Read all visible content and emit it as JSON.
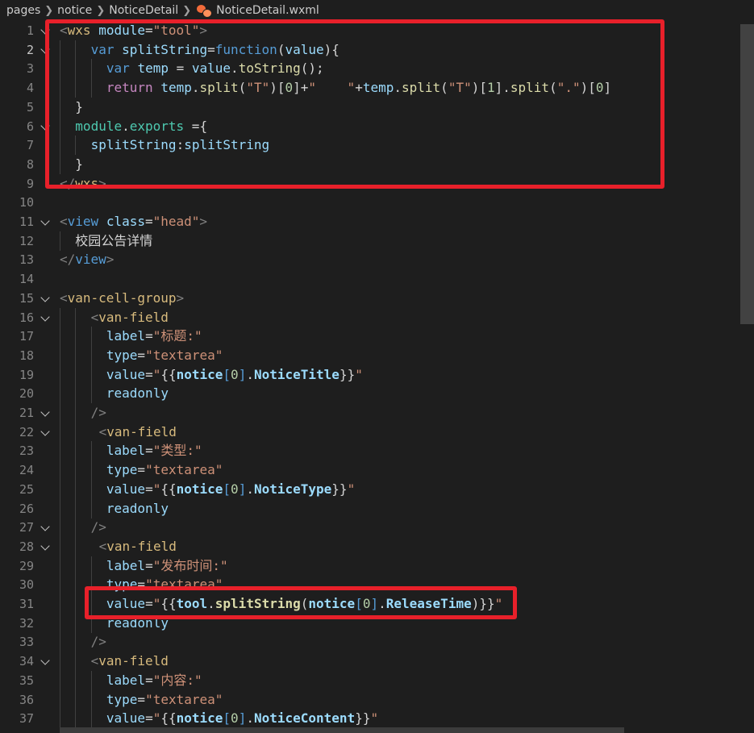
{
  "breadcrumb": {
    "items": [
      "pages",
      "notice",
      "NoticeDetail",
      "NoticeDetail.wxml"
    ],
    "file_icon": "wechat-file-icon"
  },
  "colors": {
    "tag": "#569cd6",
    "attr": "#9cdcfe",
    "string": "#ce9178",
    "text": "#d4d4d4",
    "keyword": "#569cd6",
    "function": "#dcdcaa",
    "element": "#d7ba7d",
    "number": "#b5cea8",
    "highlight": "#e8202a"
  },
  "editor": {
    "lines": [
      {
        "n": "1",
        "fold": true,
        "indent": 0,
        "tokens": [
          [
            "<",
            "#808080"
          ],
          [
            "wxs",
            "#d7ba7d"
          ],
          [
            " ",
            "#d4d4d4"
          ],
          [
            "module",
            "#9cdcfe"
          ],
          [
            "=",
            "#d4d4d4"
          ],
          [
            "\"tool\"",
            "#ce9178"
          ],
          [
            ">",
            "#808080"
          ]
        ]
      },
      {
        "n": "2",
        "fold": true,
        "active": true,
        "indent": 2,
        "tokens": [
          [
            "var",
            "#569cd6"
          ],
          [
            " ",
            "#d4d4d4"
          ],
          [
            "splitString",
            "#9cdcfe"
          ],
          [
            "=",
            "#d4d4d4"
          ],
          [
            "function",
            "#569cd6"
          ],
          [
            "(",
            "#d4d4d4"
          ],
          [
            "value",
            "#9cdcfe"
          ],
          [
            "){",
            "#d4d4d4"
          ]
        ]
      },
      {
        "n": "3",
        "indent": 3,
        "tokens": [
          [
            "var",
            "#569cd6"
          ],
          [
            " ",
            "#d4d4d4"
          ],
          [
            "temp",
            "#9cdcfe"
          ],
          [
            " = ",
            "#d4d4d4"
          ],
          [
            "value",
            "#9cdcfe"
          ],
          [
            ".",
            "#d4d4d4"
          ],
          [
            "toString",
            "#dcdcaa"
          ],
          [
            "();",
            "#d4d4d4"
          ]
        ]
      },
      {
        "n": "4",
        "indent": 3,
        "tokens": [
          [
            "return",
            "#c586c0"
          ],
          [
            " ",
            "#d4d4d4"
          ],
          [
            "temp",
            "#9cdcfe"
          ],
          [
            ".",
            "#d4d4d4"
          ],
          [
            "split",
            "#dcdcaa"
          ],
          [
            "(",
            "#d4d4d4"
          ],
          [
            "\"T\"",
            "#ce9178"
          ],
          [
            ")[",
            "#d4d4d4"
          ],
          [
            "0",
            "#b5cea8"
          ],
          [
            "]+",
            "#d4d4d4"
          ],
          [
            "\"    \"",
            "#ce9178"
          ],
          [
            "+",
            "#d4d4d4"
          ],
          [
            "temp",
            "#9cdcfe"
          ],
          [
            ".",
            "#d4d4d4"
          ],
          [
            "split",
            "#dcdcaa"
          ],
          [
            "(",
            "#d4d4d4"
          ],
          [
            "\"T\"",
            "#ce9178"
          ],
          [
            ")[",
            "#d4d4d4"
          ],
          [
            "1",
            "#b5cea8"
          ],
          [
            "].",
            "#d4d4d4"
          ],
          [
            "split",
            "#dcdcaa"
          ],
          [
            "(",
            "#d4d4d4"
          ],
          [
            "\".\"",
            "#ce9178"
          ],
          [
            ")[",
            "#d4d4d4"
          ],
          [
            "0",
            "#b5cea8"
          ],
          [
            "]",
            "#d4d4d4"
          ]
        ]
      },
      {
        "n": "5",
        "indent": 1,
        "tokens": [
          [
            "}",
            "#d4d4d4"
          ]
        ]
      },
      {
        "n": "6",
        "fold": true,
        "indent": 1,
        "tokens": [
          [
            "module",
            "#4ec9b0"
          ],
          [
            ".",
            "#d4d4d4"
          ],
          [
            "exports",
            "#4ec9b0"
          ],
          [
            " ={",
            "#d4d4d4"
          ]
        ]
      },
      {
        "n": "7",
        "indent": 2,
        "tokens": [
          [
            "splitString",
            "#9cdcfe"
          ],
          [
            ":",
            "#d4d4d4"
          ],
          [
            "splitString",
            "#9cdcfe"
          ]
        ]
      },
      {
        "n": "8",
        "indent": 1,
        "tokens": [
          [
            "}",
            "#d4d4d4"
          ]
        ]
      },
      {
        "n": "9",
        "indent": 0,
        "tokens": [
          [
            "</",
            "#808080"
          ],
          [
            "wxs",
            "#d7ba7d"
          ],
          [
            ">",
            "#808080"
          ]
        ]
      },
      {
        "n": "10",
        "indent": 0,
        "tokens": []
      },
      {
        "n": "11",
        "fold": true,
        "indent": 0,
        "tokens": [
          [
            "<",
            "#808080"
          ],
          [
            "view",
            "#569cd6"
          ],
          [
            " ",
            "#d4d4d4"
          ],
          [
            "class",
            "#9cdcfe"
          ],
          [
            "=",
            "#d4d4d4"
          ],
          [
            "\"head\"",
            "#ce9178"
          ],
          [
            ">",
            "#808080"
          ]
        ]
      },
      {
        "n": "12",
        "indent": 1,
        "tokens": [
          [
            "校园公告详情",
            "#d4d4d4"
          ]
        ]
      },
      {
        "n": "13",
        "indent": 0,
        "tokens": [
          [
            "</",
            "#808080"
          ],
          [
            "view",
            "#569cd6"
          ],
          [
            ">",
            "#808080"
          ]
        ]
      },
      {
        "n": "14",
        "indent": 0,
        "tokens": []
      },
      {
        "n": "15",
        "fold": true,
        "indent": 0,
        "tokens": [
          [
            "<",
            "#808080"
          ],
          [
            "van-cell-group",
            "#d7ba7d"
          ],
          [
            ">",
            "#808080"
          ]
        ]
      },
      {
        "n": "16",
        "fold": true,
        "indent": 2,
        "tokens": [
          [
            "<",
            "#808080"
          ],
          [
            "van-field",
            "#d7ba7d"
          ]
        ]
      },
      {
        "n": "17",
        "indent": 3,
        "tokens": [
          [
            "label",
            "#9cdcfe"
          ],
          [
            "=",
            "#d4d4d4"
          ],
          [
            "\"标题:\"",
            "#ce9178"
          ]
        ]
      },
      {
        "n": "18",
        "indent": 3,
        "tokens": [
          [
            "type",
            "#9cdcfe"
          ],
          [
            "=",
            "#d4d4d4"
          ],
          [
            "\"textarea\"",
            "#ce9178"
          ]
        ]
      },
      {
        "n": "19",
        "indent": 3,
        "tokens": [
          [
            "value",
            "#9cdcfe"
          ],
          [
            "=",
            "#d4d4d4"
          ],
          [
            "\"",
            "#ce9178"
          ],
          [
            "{{",
            "#d4d4d4"
          ],
          [
            "notice",
            "#9cdcfe",
            true
          ],
          [
            "[",
            "#569cd6"
          ],
          [
            "0",
            "#b5cea8"
          ],
          [
            "]",
            "#569cd6"
          ],
          [
            ".",
            "#d4d4d4"
          ],
          [
            "NoticeTitle",
            "#9cdcfe",
            true
          ],
          [
            "}}",
            "#d4d4d4"
          ],
          [
            "\"",
            "#ce9178"
          ]
        ]
      },
      {
        "n": "20",
        "indent": 3,
        "tokens": [
          [
            "readonly",
            "#9cdcfe"
          ]
        ]
      },
      {
        "n": "21",
        "fold": true,
        "indent": 2,
        "tokens": [
          [
            "/>",
            "#808080"
          ]
        ]
      },
      {
        "n": "22",
        "fold": true,
        "indent": 2,
        "extra": 10,
        "tokens": [
          [
            "<",
            "#808080"
          ],
          [
            "van-field",
            "#d7ba7d"
          ]
        ]
      },
      {
        "n": "23",
        "indent": 3,
        "tokens": [
          [
            "label",
            "#9cdcfe"
          ],
          [
            "=",
            "#d4d4d4"
          ],
          [
            "\"类型:\"",
            "#ce9178"
          ]
        ]
      },
      {
        "n": "24",
        "indent": 3,
        "tokens": [
          [
            "type",
            "#9cdcfe"
          ],
          [
            "=",
            "#d4d4d4"
          ],
          [
            "\"textarea\"",
            "#ce9178"
          ]
        ]
      },
      {
        "n": "25",
        "indent": 3,
        "tokens": [
          [
            "value",
            "#9cdcfe"
          ],
          [
            "=",
            "#d4d4d4"
          ],
          [
            "\"",
            "#ce9178"
          ],
          [
            "{{",
            "#d4d4d4"
          ],
          [
            "notice",
            "#9cdcfe",
            true
          ],
          [
            "[",
            "#569cd6"
          ],
          [
            "0",
            "#b5cea8"
          ],
          [
            "]",
            "#569cd6"
          ],
          [
            ".",
            "#d4d4d4"
          ],
          [
            "NoticeType",
            "#9cdcfe",
            true
          ],
          [
            "}}",
            "#d4d4d4"
          ],
          [
            "\"",
            "#ce9178"
          ]
        ]
      },
      {
        "n": "26",
        "indent": 3,
        "tokens": [
          [
            "readonly",
            "#9cdcfe"
          ]
        ]
      },
      {
        "n": "27",
        "fold": true,
        "indent": 2,
        "tokens": [
          [
            "/>",
            "#808080"
          ]
        ]
      },
      {
        "n": "28",
        "fold": true,
        "indent": 2,
        "extra": 10,
        "tokens": [
          [
            "<",
            "#808080"
          ],
          [
            "van-field",
            "#d7ba7d"
          ]
        ]
      },
      {
        "n": "29",
        "indent": 3,
        "tokens": [
          [
            "label",
            "#9cdcfe"
          ],
          [
            "=",
            "#d4d4d4"
          ],
          [
            "\"发布时间:\"",
            "#ce9178"
          ]
        ]
      },
      {
        "n": "30",
        "indent": 3,
        "tokens": [
          [
            "type",
            "#9cdcfe"
          ],
          [
            "=",
            "#d4d4d4"
          ],
          [
            "\"textarea\"",
            "#ce9178"
          ]
        ]
      },
      {
        "n": "31",
        "indent": 3,
        "tokens": [
          [
            "value",
            "#9cdcfe"
          ],
          [
            "=",
            "#d4d4d4"
          ],
          [
            "\"",
            "#ce9178"
          ],
          [
            "{{",
            "#d4d4d4"
          ],
          [
            "tool",
            "#9cdcfe",
            true
          ],
          [
            ".",
            "#d4d4d4"
          ],
          [
            "splitString",
            "#dcdcaa",
            true
          ],
          [
            "(",
            "#d4d4d4"
          ],
          [
            "notice",
            "#9cdcfe",
            true
          ],
          [
            "[",
            "#569cd6"
          ],
          [
            "0",
            "#b5cea8"
          ],
          [
            "]",
            "#569cd6"
          ],
          [
            ".",
            "#d4d4d4"
          ],
          [
            "ReleaseTime",
            "#9cdcfe",
            true
          ],
          [
            ")",
            "#d4d4d4"
          ],
          [
            "}}",
            "#d4d4d4"
          ],
          [
            "\"",
            "#ce9178"
          ]
        ]
      },
      {
        "n": "32",
        "indent": 3,
        "tokens": [
          [
            "readonly",
            "#9cdcfe"
          ]
        ]
      },
      {
        "n": "33",
        "indent": 2,
        "tokens": [
          [
            "/>",
            "#808080"
          ]
        ]
      },
      {
        "n": "34",
        "fold": true,
        "indent": 2,
        "tokens": [
          [
            "<",
            "#808080"
          ],
          [
            "van-field",
            "#d7ba7d"
          ]
        ]
      },
      {
        "n": "35",
        "indent": 3,
        "tokens": [
          [
            "label",
            "#9cdcfe"
          ],
          [
            "=",
            "#d4d4d4"
          ],
          [
            "\"内容:\"",
            "#ce9178"
          ]
        ]
      },
      {
        "n": "36",
        "indent": 3,
        "tokens": [
          [
            "type",
            "#9cdcfe"
          ],
          [
            "=",
            "#d4d4d4"
          ],
          [
            "\"textarea\"",
            "#ce9178"
          ]
        ]
      },
      {
        "n": "37",
        "indent": 3,
        "tokens": [
          [
            "value",
            "#9cdcfe"
          ],
          [
            "=",
            "#d4d4d4"
          ],
          [
            "\"",
            "#ce9178"
          ],
          [
            "{{",
            "#d4d4d4"
          ],
          [
            "notice",
            "#9cdcfe",
            true
          ],
          [
            "[",
            "#569cd6"
          ],
          [
            "0",
            "#b5cea8"
          ],
          [
            "]",
            "#569cd6"
          ],
          [
            ".",
            "#d4d4d4"
          ],
          [
            "NoticeContent",
            "#9cdcfe",
            true
          ],
          [
            "}}",
            "#d4d4d4"
          ],
          [
            "\"",
            "#ce9178"
          ]
        ]
      }
    ]
  }
}
